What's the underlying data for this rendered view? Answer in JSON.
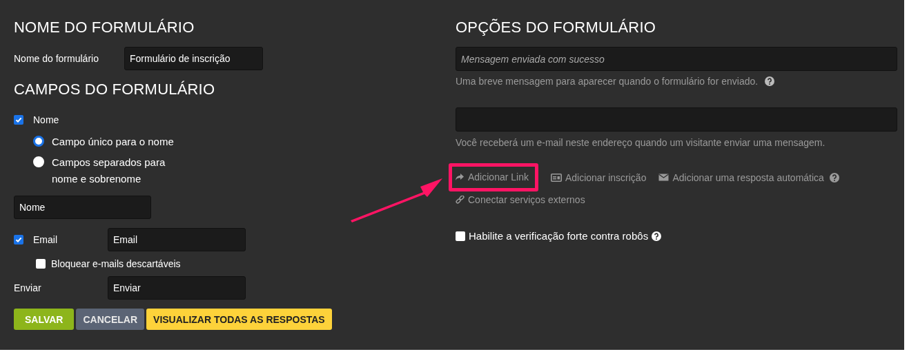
{
  "form_name_section": {
    "title": "NOME DO FORMULÁRIO",
    "label": "Nome do formulário",
    "value": "Formulário de inscrição"
  },
  "fields_section": {
    "title": "CAMPOS DO FORMULÁRIO",
    "name_field": {
      "label": "Nome",
      "checked": true,
      "value": "Nome",
      "options": [
        {
          "label": "Campo único para o nome",
          "selected": true
        },
        {
          "label": "Campos separados para nome e sobrenome",
          "selected": false
        }
      ]
    },
    "email_field": {
      "label": "Email",
      "checked": true,
      "value": "Email",
      "block_disposable": {
        "label": "Bloquear e-mails descartáveis",
        "checked": false
      }
    },
    "submit_field": {
      "label": "Enviar",
      "value": "Enviar"
    }
  },
  "buttons": [
    {
      "label": "SALVAR",
      "kind": "save"
    },
    {
      "label": "CANCELAR",
      "kind": "cancel"
    },
    {
      "label": "VISUALIZAR TODAS AS RESPOSTAS",
      "kind": "view"
    }
  ],
  "options_section": {
    "title": "OPÇÕES DO FORMULÁRIO",
    "success_message": {
      "placeholder": "Mensagem enviada com sucesso",
      "hint": "Uma breve mensagem para aparecer quando o formulário for enviado."
    },
    "email": {
      "hint": "Você receberá um e-mail neste endereço quando um visitante enviar uma mensagem."
    },
    "actions": [
      {
        "label": "Adicionar Link",
        "highlighted": true,
        "help": false
      },
      {
        "label": "Adicionar inscrição",
        "highlighted": false,
        "help": false
      },
      {
        "label": "Adicionar uma resposta automática",
        "highlighted": false,
        "help": true
      },
      {
        "label": "Conectar serviços externos",
        "highlighted": false,
        "help": false
      }
    ],
    "robot_check": {
      "label": "Habilite a verificação forte contra robôs",
      "checked": false
    }
  },
  "callout": {
    "color": "#ff1464"
  }
}
